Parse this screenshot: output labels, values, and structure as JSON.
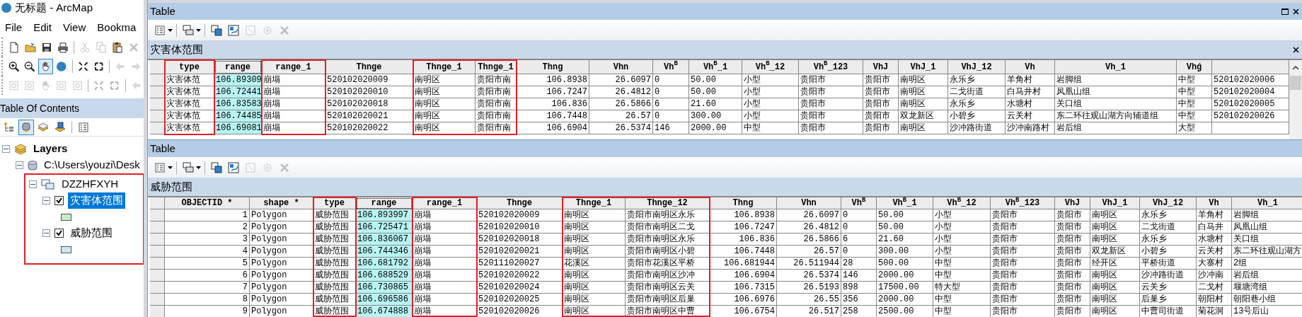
{
  "app": {
    "title": "无标题 - ArcMap",
    "menu": [
      "File",
      "Edit",
      "View",
      "Bookma"
    ],
    "toolbars": [
      [
        {
          "kind": "new",
          "disabled": false,
          "selected": false
        },
        {
          "kind": "open",
          "disabled": false,
          "selected": false
        },
        {
          "kind": "save",
          "disabled": false,
          "selected": false
        },
        {
          "kind": "print",
          "disabled": false,
          "selected": false
        },
        {
          "kind": "separator"
        },
        {
          "kind": "cut",
          "disabled": true,
          "selected": false
        },
        {
          "kind": "copy",
          "disabled": true,
          "selected": false
        },
        {
          "kind": "paste",
          "disabled": false,
          "selected": false
        },
        {
          "kind": "delete",
          "disabled": true,
          "selected": false
        }
      ],
      [
        {
          "kind": "zoom-in",
          "disabled": false,
          "selected": false
        },
        {
          "kind": "zoom-out",
          "disabled": false,
          "selected": false
        },
        {
          "kind": "pan",
          "disabled": false,
          "selected": true
        },
        {
          "kind": "globe",
          "disabled": false,
          "selected": false
        },
        {
          "kind": "separator"
        },
        {
          "kind": "zoom-in-fixed",
          "disabled": false,
          "selected": false
        },
        {
          "kind": "zoom-out-fixed",
          "disabled": false,
          "selected": false
        },
        {
          "kind": "separator"
        },
        {
          "kind": "back",
          "disabled": true,
          "selected": false
        },
        {
          "kind": "forward",
          "disabled": true,
          "selected": false
        }
      ],
      [
        {
          "kind": "page",
          "disabled": true,
          "selected": false
        },
        {
          "kind": "page",
          "disabled": true,
          "selected": false
        },
        {
          "kind": "pan",
          "disabled": true,
          "selected": false
        },
        {
          "kind": "page",
          "disabled": true,
          "selected": false
        },
        {
          "kind": "page",
          "disabled": true,
          "selected": false
        },
        {
          "kind": "separator"
        },
        {
          "kind": "zoom-in-fixed",
          "disabled": true,
          "selected": false
        },
        {
          "kind": "zoom-out-fixed",
          "disabled": true,
          "selected": false
        },
        {
          "kind": "separator"
        },
        {
          "kind": "back",
          "disabled": true,
          "selected": false
        }
      ]
    ]
  },
  "toc": {
    "title": "Table Of Contents",
    "tools": [
      {
        "kind": "drawing-order",
        "selected": false
      },
      {
        "kind": "source",
        "selected": true
      },
      {
        "kind": "visibility",
        "selected": false
      },
      {
        "kind": "selection",
        "selected": false
      },
      {
        "kind": "separator"
      },
      {
        "kind": "options",
        "selected": false
      }
    ],
    "tree": [
      {
        "kind": "root",
        "label": "Layers",
        "expanded": true,
        "children": [
          {
            "kind": "database",
            "label": "C:\\Users\\youzi\\Desk",
            "expanded": true,
            "children": [
              {
                "kind": "group",
                "label": "DZZHFXYH",
                "expanded": true,
                "highlighted": true,
                "children": [
                  {
                    "kind": "layer",
                    "label": "灾害体范围",
                    "expanded": true,
                    "checked": true,
                    "selected": true,
                    "color": "#c8eec8"
                  },
                  {
                    "kind": "layer",
                    "label": "威胁范围",
                    "expanded": true,
                    "checked": true,
                    "selected": false,
                    "color": "#cce6f6"
                  }
                ]
              }
            ]
          }
        ]
      }
    ]
  },
  "tables": [
    {
      "title": "Table",
      "layer": "灾害体范围",
      "tools": [
        {
          "kind": "options",
          "disabled": false
        },
        {
          "kind": "related",
          "disabled": false
        },
        {
          "kind": "select-attributes",
          "disabled": false
        },
        {
          "kind": "switch",
          "disabled": false
        },
        {
          "kind": "clear",
          "disabled": true
        },
        {
          "kind": "zoom-selected",
          "disabled": true
        },
        {
          "kind": "delete",
          "disabled": true
        }
      ],
      "columns": [
        {
          "label": "type",
          "kind": "text",
          "selected": false,
          "highlighted": true
        },
        {
          "label": "range",
          "kind": "text",
          "selected": true,
          "highlighted": false
        },
        {
          "label": "range_1",
          "kind": "text",
          "selected": false,
          "highlighted": true
        },
        {
          "label": "Thnge",
          "kind": "text",
          "selected": false,
          "highlighted": false
        },
        {
          "label": "Thnge_1",
          "kind": "text",
          "selected": false,
          "highlighted": true
        },
        {
          "label": "Thnge_1",
          "kind": "text",
          "selected": false,
          "highlighted": true
        },
        {
          "label": "Thng",
          "kind": "numeric",
          "selected": false,
          "highlighted": false
        },
        {
          "label": "Vhn",
          "kind": "numeric",
          "selected": false,
          "highlighted": false
        },
        {
          "label": "Vh$^{B}$",
          "kind": "text",
          "selected": false,
          "highlighted": false
        },
        {
          "label": "Vh$^{B}$_1",
          "kind": "text",
          "selected": false,
          "highlighted": false
        },
        {
          "label": "Vh$^{B}$_12",
          "kind": "text",
          "selected": false,
          "highlighted": false
        },
        {
          "label": "Vh$^{B}$_123",
          "kind": "text",
          "selected": false,
          "highlighted": false
        },
        {
          "label": "VhJ",
          "kind": "text",
          "selected": false,
          "highlighted": false
        },
        {
          "label": "VhJ_1",
          "kind": "text",
          "selected": false,
          "highlighted": false
        },
        {
          "label": "VhJ_12",
          "kind": "text",
          "selected": false,
          "highlighted": false
        },
        {
          "label": "Vh",
          "kind": "text",
          "selected": false,
          "highlighted": false
        },
        {
          "label": "Vh_1",
          "kind": "text",
          "selected": false,
          "highlighted": false
        },
        {
          "label": "Vhǵ",
          "kind": "text",
          "selected": false,
          "highlighted": false
        },
        {
          "kind": "text",
          "selected": false
        }
      ],
      "rows": [
        [
          "灾害体范",
          "106.89309",
          "崩塌",
          "520102020009",
          "南明区",
          "贵阳市南",
          "106.8938",
          "26.6097",
          "0",
          "50.00",
          "小型",
          "贵阳市",
          "贵阳市",
          "南明区",
          "永乐乡",
          "羊角村",
          "岩脚组",
          "中型",
          "520102020006"
        ],
        [
          "灾害体范",
          "106.72441",
          "崩塌",
          "520102020010",
          "南明区",
          "贵阳市南",
          "106.7247",
          "26.4812",
          "0",
          "50.00",
          "小型",
          "贵阳市",
          "贵阳市",
          "南明区",
          "二戈街道",
          "白马井村",
          "凤凰山组",
          "中型",
          "520102020004"
        ],
        [
          "灾害体范",
          "106.83583",
          "崩塌",
          "520102020018",
          "南明区",
          "贵阳市南",
          "106.836",
          "26.5866",
          "6",
          "21.60",
          "小型",
          "贵阳市",
          "贵阳市",
          "南明区",
          "永乐乡",
          "水塘村",
          "关口组",
          "中型",
          "520102020005"
        ],
        [
          "灾害体范",
          "106.74485",
          "崩塌",
          "520102020021",
          "南明区",
          "贵阳市南",
          "106.7448",
          "26.57",
          "0",
          "300.00",
          "小型",
          "贵阳市",
          "贵阳市",
          "双龙新区",
          "小碧乡",
          "云关村",
          "东二环往观山湖方向辅道组",
          "中型",
          "520102020026"
        ],
        [
          "灾害体范",
          "106.69081",
          "崩塌",
          "520102020022",
          "南明区",
          "贵阳市南",
          "106.6904",
          "26.5374",
          "146",
          "2000.00",
          "中型",
          "贵阳市",
          "贵阳市",
          "南明区",
          "沙冲路街道",
          "沙冲南路村",
          "岩后组",
          "大型",
          null
        ]
      ]
    },
    {
      "title": "Table",
      "layer": "威胁范围",
      "tools": [
        {
          "kind": "options",
          "disabled": false
        },
        {
          "kind": "related",
          "disabled": false
        },
        {
          "kind": "select-attributes",
          "disabled": false
        },
        {
          "kind": "switch",
          "disabled": false
        },
        {
          "kind": "clear",
          "disabled": true
        },
        {
          "kind": "zoom-selected",
          "disabled": true
        },
        {
          "kind": "delete",
          "disabled": true
        }
      ],
      "columns": [
        {
          "label": "OBJECTID *",
          "kind": "numeric",
          "selected": false,
          "highlighted": false
        },
        {
          "label": "shape *",
          "kind": "text",
          "selected": false,
          "highlighted": false
        },
        {
          "label": "type",
          "kind": "text",
          "selected": false,
          "highlighted": true
        },
        {
          "label": "range",
          "kind": "text",
          "selected": true,
          "highlighted": false
        },
        {
          "label": "range_1",
          "kind": "text",
          "selected": false,
          "highlighted": true
        },
        {
          "label": "Thnge",
          "kind": "text",
          "selected": false,
          "highlighted": false
        },
        {
          "label": "Thnge_1",
          "kind": "text",
          "selected": false,
          "highlighted": true
        },
        {
          "label": "Thnge_12",
          "kind": "text",
          "selected": false,
          "highlighted": true
        },
        {
          "label": "Thng",
          "kind": "numeric",
          "selected": false,
          "highlighted": false
        },
        {
          "label": "Vhn",
          "kind": "numeric",
          "selected": false,
          "highlighted": false
        },
        {
          "label": "Vh$^{B}$",
          "kind": "text",
          "selected": false,
          "highlighted": false
        },
        {
          "label": "Vh$^{B}$_1",
          "kind": "text",
          "selected": false,
          "highlighted": false
        },
        {
          "label": "Vh$^{B}$_12",
          "kind": "text",
          "selected": false,
          "highlighted": false
        },
        {
          "label": "Vh$^{B}$_123",
          "kind": "text",
          "selected": false,
          "highlighted": false
        },
        {
          "label": "VhJ",
          "kind": "text",
          "selected": false,
          "highlighted": false
        },
        {
          "label": "VhJ_1",
          "kind": "text",
          "selected": false,
          "highlighted": false
        },
        {
          "label": "VhJ_12",
          "kind": "text",
          "selected": false,
          "highlighted": false
        },
        {
          "label": "Vh",
          "kind": "text",
          "selected": false,
          "highlighted": false
        },
        {
          "label": "Vh_1",
          "kind": "text",
          "selected": false,
          "highlighted": false
        }
      ],
      "rows": [
        [
          "1",
          "Polygon",
          "威胁范围",
          "106.893997",
          "崩塌",
          "520102020009",
          "南明区",
          "贵阳市南明区永乐",
          "106.8938",
          "26.6097",
          "0",
          "50.00",
          "小型",
          "贵阳市",
          "贵阳市",
          "南明区",
          "永乐乡",
          "羊角村",
          "岩脚组"
        ],
        [
          "2",
          "Polygon",
          "威胁范围",
          "106.725471",
          "崩塌",
          "520102020010",
          "南明区",
          "贵阳市南明区二戈",
          "106.7247",
          "26.4812",
          "0",
          "50.00",
          "小型",
          "贵阳市",
          "贵阳市",
          "南明区",
          "二戈街道",
          "白马井",
          "凤凰山组"
        ],
        [
          "3",
          "Polygon",
          "威胁范围",
          "106.836067",
          "崩塌",
          "520102020018",
          "南明区",
          "贵阳市南明区永乐",
          "106.836",
          "26.5866",
          "6",
          "21.60",
          "小型",
          "贵阳市",
          "贵阳市",
          "南明区",
          "永乐乡",
          "水塘村",
          "关口组"
        ],
        [
          "4",
          "Polygon",
          "威胁范围",
          "106.744346",
          "崩塌",
          "520102020021",
          "南明区",
          "贵阳市南明区小碧",
          "106.7448",
          "26.57",
          "0",
          "300.00",
          "小型",
          "贵阳市",
          "贵阳市",
          "双龙新区",
          "小碧乡",
          "云关村",
          "东二环往观山湖方"
        ],
        [
          "5",
          "Polygon",
          "威胁范围",
          "106.681792",
          "崩塌",
          "520111020027",
          "花溪区",
          "贵阳市花溪区平桥",
          "106.681944",
          "26.511944",
          "28",
          "500.00",
          "中型",
          "贵阳市",
          "贵阳市",
          "经开区",
          "平桥街道",
          "大寨村",
          "2组"
        ],
        [
          "6",
          "Polygon",
          "威胁范围",
          "106.688529",
          "崩塌",
          "520102020022",
          "南明区",
          "贵阳市南明区沙冲",
          "106.6904",
          "26.5374",
          "146",
          "2000.00",
          "中型",
          "贵阳市",
          "贵阳市",
          "南明区",
          "沙冲路街道",
          "沙冲南",
          "岩后组"
        ],
        [
          "7",
          "Polygon",
          "威胁范围",
          "106.730865",
          "崩塌",
          "520102020024",
          "南明区",
          "贵阳市南明区云关",
          "106.7315",
          "26.5193",
          "898",
          "17500.00",
          "特大型",
          "贵阳市",
          "贵阳市",
          "南明区",
          "云关乡",
          "二戈村",
          "堰塘湾组"
        ],
        [
          "8",
          "Polygon",
          "威胁范围",
          "106.696586",
          "崩塌",
          "520102020025",
          "南明区",
          "贵阳市南明区后巢",
          "106.6976",
          "26.55",
          "356",
          "2000.00",
          "中型",
          "贵阳市",
          "贵阳市",
          "南明区",
          "后巢乡",
          "朝阳村",
          "朝阳巷小组"
        ],
        [
          "9",
          "Polygon",
          "威胁范围",
          "106.674888",
          "崩塌",
          "520102020026",
          "南明区",
          "贵阳市南明区中曹",
          "106.6754",
          "26.517",
          "258",
          "2500.00",
          "中型",
          "贵阳市",
          "贵阳市",
          "南明区",
          "中曹司街道",
          "菊花洞",
          "13号后山"
        ]
      ]
    }
  ]
}
